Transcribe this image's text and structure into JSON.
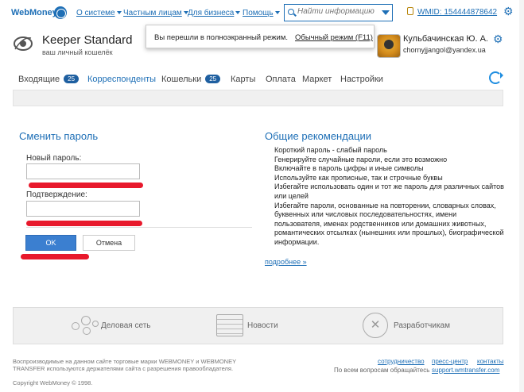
{
  "top_nav": {
    "brand": "WebMoney",
    "items": [
      {
        "label": "О системе"
      },
      {
        "label": "Частным лицам"
      },
      {
        "label": "Для бизнеса"
      },
      {
        "label": "Помощь"
      }
    ],
    "search_placeholder": "Найти информацию",
    "wmid": "WMID: 154444878642"
  },
  "keeper": {
    "title": "Keeper Standard",
    "subtitle": "ваш личный кошелёк"
  },
  "notice": {
    "message": "Вы перешли в полноэкранный режим.",
    "action": "Обычный режим (F11)"
  },
  "user": {
    "name": "Кульбачинская Ю. А.",
    "email": "chornyjjangol@yandex.ua"
  },
  "tabs": [
    {
      "label": "Входящие",
      "badge": "25"
    },
    {
      "label": "Корреспонденты"
    },
    {
      "label": "Кошельки",
      "badge": "25"
    },
    {
      "label": "Карты"
    },
    {
      "label": "Оплата"
    },
    {
      "label": "Маркет"
    },
    {
      "label": "Настройки"
    }
  ],
  "change_password": {
    "title": "Сменить пароль",
    "new_password_label": "Новый пароль:",
    "confirm_label": "Подтверждение:",
    "ok_label": "OK",
    "cancel_label": "Отмена"
  },
  "recommendations": {
    "title": "Общие рекомендации",
    "lines": [
      "Короткий пароль - слабый пароль",
      "Генерируйте случайные пароли, если это возможно",
      "Включайте в пароль цифры и иные символы",
      "Используйте как прописные, так и строчные буквы",
      "Избегайте использовать один и тот же пароль для различных сайтов или целей",
      "Избегайте пароли, основанные на повторении, словарных словах, буквенных или числовых последовательностях, имени пользователя, именах родственников или домашних животных, романтических отсылках (нынешних или прошлых), биографической информации."
    ],
    "more_link": "подробнее »"
  },
  "footer_panel": {
    "items": [
      {
        "label": "Деловая сеть"
      },
      {
        "label": "Новости"
      },
      {
        "label": "Разработчикам"
      }
    ]
  },
  "footer": {
    "legal": "Воспроизводимые на данном сайте торговые марки WEBMONEY и WEBMONEY TRANSFER используются держателями сайта с разрешения правообладателя.",
    "copyright": "Copyright WebMoney © 1998.",
    "links": [
      "сотрудничество",
      "пресс-центр",
      "контакты"
    ],
    "support_question": "По всем вопросам обращайтесь",
    "support_link": "support.wmtransfer.com"
  },
  "colors": {
    "accent": "#1e6fb6",
    "redaction": "#e8192c",
    "ok_button": "#3b7fd0"
  }
}
